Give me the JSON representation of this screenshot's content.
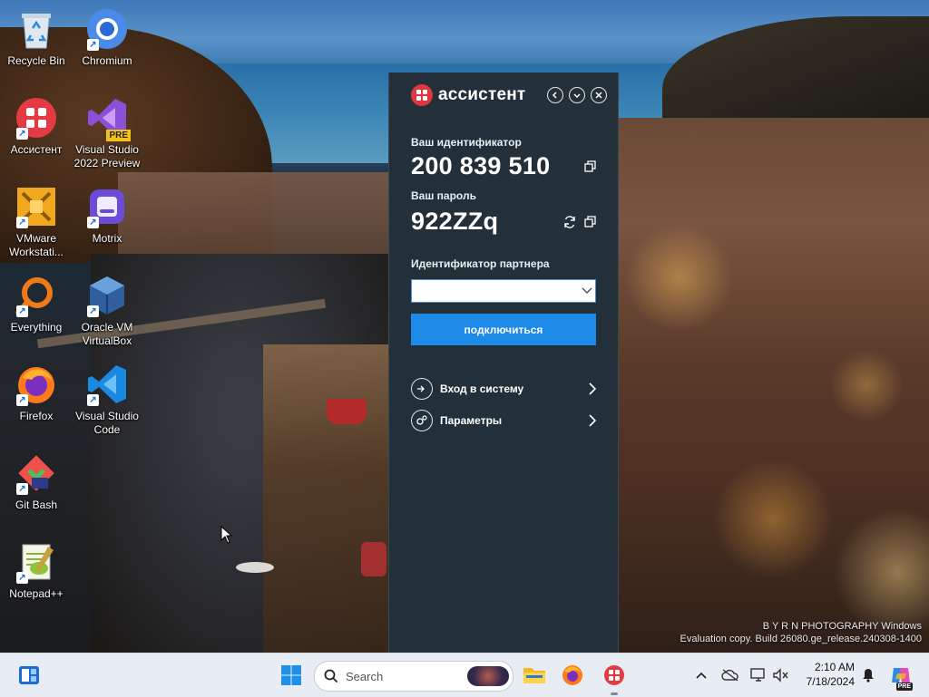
{
  "desktop": {
    "icons": [
      {
        "label": "Recycle Bin",
        "icon": "recycle-bin-icon"
      },
      {
        "label": "Chromium",
        "icon": "chromium-icon"
      },
      {
        "label": "Ассистент",
        "icon": "assistant-icon"
      },
      {
        "label": "Visual Studio 2022 Preview",
        "icon": "visual-studio-icon",
        "badge": "PRE"
      },
      {
        "label": "VMware Workstati...",
        "icon": "vmware-icon"
      },
      {
        "label": "Motrix",
        "icon": "motrix-icon"
      },
      {
        "label": "Everything",
        "icon": "everything-icon"
      },
      {
        "label": "Oracle VM VirtualBox",
        "icon": "virtualbox-icon"
      },
      {
        "label": "Firefox",
        "icon": "firefox-icon"
      },
      {
        "label": "Visual Studio Code",
        "icon": "vscode-icon"
      },
      {
        "label": "Git Bash",
        "icon": "git-bash-icon"
      },
      {
        "label": "Notepad++",
        "icon": "notepad-plus-plus-icon"
      }
    ],
    "watermark_line1": "B Y R N   PHOTOGRAPHY   Windows",
    "watermark_line2": "Evaluation copy. Build 26080.ge_release.240308-1400"
  },
  "assistant": {
    "brand": "ассистент",
    "id_label": "Ваш идентификатор",
    "id_value": "200 839 510",
    "password_label": "Ваш пароль",
    "password_value": "922ZZq",
    "partner_label": "Идентификатор партнера",
    "partner_value": "",
    "connect_label": "подключиться",
    "login_label": "Вход в систему",
    "settings_label": "Параметры"
  },
  "taskbar": {
    "search_placeholder": "Search",
    "time": "2:10 AM",
    "date": "7/18/2024",
    "copilot_badge": "PRE"
  },
  "colors": {
    "panel_bg": "#23303a",
    "accent_blue": "#1e8ae8",
    "brand_red": "#e03640",
    "taskbar_bg": "#e8edf3"
  }
}
